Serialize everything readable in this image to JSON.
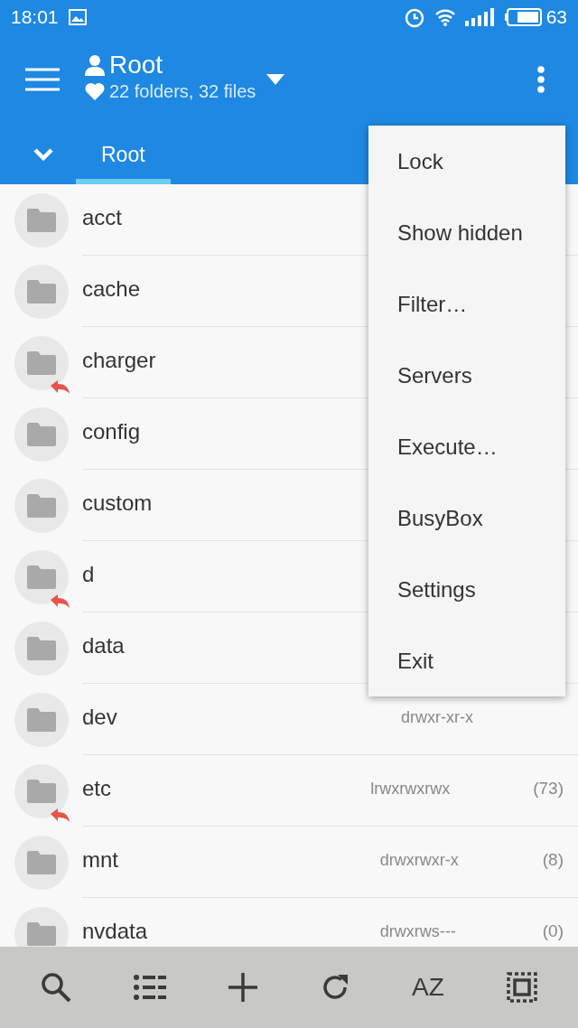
{
  "status_bar": {
    "time": "18:01",
    "battery": "63"
  },
  "app_bar": {
    "title": "Root",
    "subtitle": "22 folders, 32 files"
  },
  "tabs": [
    {
      "label": "Root",
      "selected": true
    }
  ],
  "files": [
    {
      "name": "acct",
      "symlink": false
    },
    {
      "name": "cache",
      "symlink": false
    },
    {
      "name": "charger",
      "symlink": true
    },
    {
      "name": "config",
      "symlink": false
    },
    {
      "name": "custom",
      "symlink": false
    },
    {
      "name": "d",
      "symlink": true
    },
    {
      "name": "data",
      "symlink": false
    },
    {
      "name": "dev",
      "symlink": false,
      "permissions": "drwxr-xr-x"
    },
    {
      "name": "etc",
      "symlink": true,
      "permissions": "lrwxrwxrwx",
      "count": "(73)"
    },
    {
      "name": "mnt",
      "symlink": false,
      "permissions": "drwxrwxr-x",
      "count": "(8)"
    },
    {
      "name": "nvdata",
      "symlink": false,
      "permissions": "drwxrws---",
      "count": "(0)"
    }
  ],
  "menu": [
    "Lock",
    "Show hidden",
    "Filter…",
    "Servers",
    "Execute…",
    "BusyBox",
    "Settings",
    "Exit"
  ],
  "toolbar": [
    {
      "kind": "search"
    },
    {
      "kind": "list"
    },
    {
      "kind": "add"
    },
    {
      "kind": "refresh"
    },
    {
      "kind": "sort",
      "label": "AZ"
    },
    {
      "kind": "select"
    }
  ]
}
